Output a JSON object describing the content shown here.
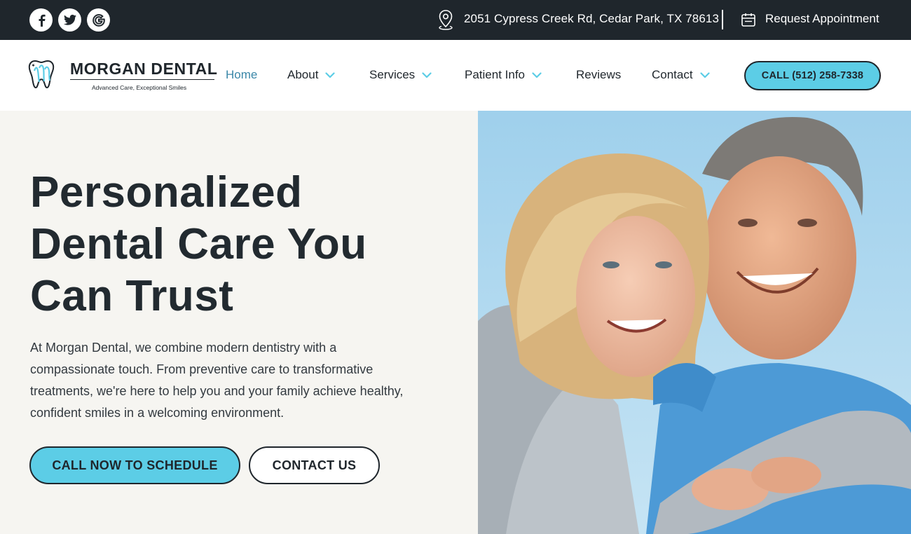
{
  "topbar": {
    "social": [
      {
        "name": "facebook-icon",
        "glyph": "f"
      },
      {
        "name": "twitter-icon",
        "glyph": "bird"
      },
      {
        "name": "google-icon",
        "glyph": "G"
      }
    ],
    "address": "2051 Cypress Creek Rd, Cedar Park, TX 78613",
    "address_icon": "map-pin-icon",
    "appointment": "Request Appointment",
    "appointment_icon": "calendar-icon"
  },
  "header": {
    "brand": "MORGAN DENTAL",
    "tagline": "Advanced Care, Exceptional Smiles",
    "logo_icon": "tooth-icon",
    "nav": [
      {
        "label": "Home",
        "active": true,
        "dropdown": false
      },
      {
        "label": "About",
        "active": false,
        "dropdown": true
      },
      {
        "label": "Services",
        "active": false,
        "dropdown": true
      },
      {
        "label": "Patient Info",
        "active": false,
        "dropdown": true
      },
      {
        "label": "Reviews",
        "active": false,
        "dropdown": false
      },
      {
        "label": "Contact",
        "active": false,
        "dropdown": true
      }
    ],
    "call_button": "CALL (512) 258-7338"
  },
  "hero": {
    "title_lines": [
      "Personalized",
      "Dental Care You",
      "Can Trust"
    ],
    "paragraph": "At Morgan Dental, we combine modern dentistry with a compassionate touch. From preventive care to transformative treatments, we're here to help you and your family achieve healthy, confident smiles in a welcoming environment.",
    "primary_button": "CALL NOW TO SCHEDULE",
    "secondary_button": "CONTACT US"
  },
  "colors": {
    "accent": "#5ccde6",
    "dark": "#1f262c",
    "active_nav": "#3a87a8",
    "hero_bg": "#f6f5f1"
  }
}
